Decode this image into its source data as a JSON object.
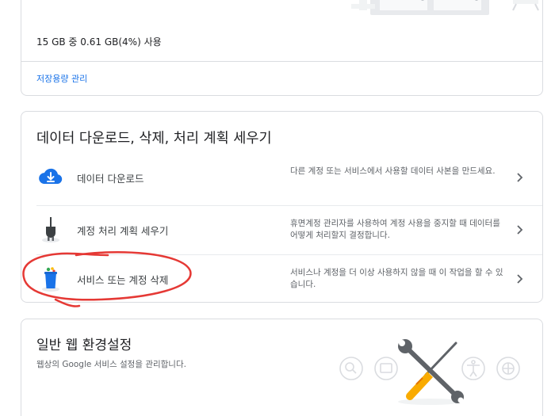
{
  "storage": {
    "usage_text": "15 GB 중 0.61 GB(4%) 사용",
    "usage_percent": 4,
    "manage_link": "저장용량 관리"
  },
  "data_section": {
    "title": "데이터 다운로드, 삭제, 처리 계획 세우기",
    "items": [
      {
        "label": "데이터 다운로드",
        "description": "다른 계정 또는 서비스에서 사용할 데이터 사본을 만드세요.",
        "icon": "cloud-download-icon"
      },
      {
        "label": "계정 처리 계획 세우기",
        "description": "휴면계정 관리자를 사용하여 계정 사용을 중지할 때 데이터를 어떻게 처리할지 결정합니다.",
        "icon": "plug-icon"
      },
      {
        "label": "서비스 또는 계정 삭제",
        "description": "서비스나 계정을 더 이상 사용하지 않을 때 이 작업을 할 수 있습니다.",
        "icon": "trash-can-icon"
      }
    ]
  },
  "general_section": {
    "title": "일반 웹 환경설정",
    "subtitle": "웹상의 Google 서비스 설정을 관리합니다."
  },
  "colors": {
    "link": "#1a73e8",
    "annotation": "#e53935",
    "border": "#dadce0"
  }
}
